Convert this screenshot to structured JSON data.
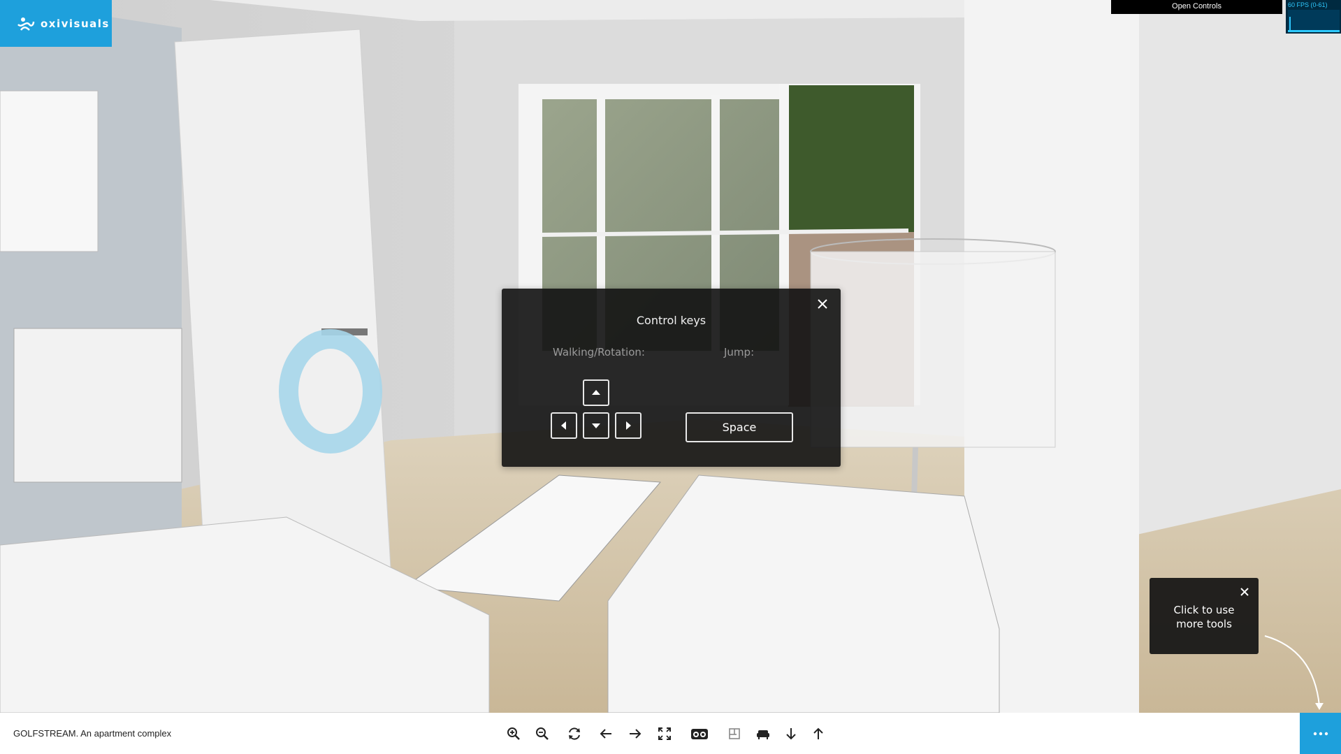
{
  "logo": {
    "text": "oxivisuals",
    "color": "#1ea0dc"
  },
  "top_right": {
    "open_controls_label": "Open Controls",
    "fps_text": "60 FPS (0-61)"
  },
  "dialog": {
    "title": "Control keys",
    "walking_label": "Walking/Rotation:",
    "jump_label": "Jump:",
    "keys": {
      "up_icon": "arrow-up-icon",
      "left_icon": "arrow-left-icon",
      "down_icon": "arrow-down-icon",
      "right_icon": "arrow-right-icon",
      "space_label": "Space"
    },
    "close_icon": "close-icon"
  },
  "tooltip": {
    "text_line1": "Click to use",
    "text_line2": "more tools",
    "close_icon": "close-icon"
  },
  "bottom_bar": {
    "project_title": "GOLFSTREAM. An apartment complex",
    "tools": [
      "zoom-in-icon",
      "zoom-out-icon",
      "rotate-icon",
      "arrow-left-icon",
      "arrow-right-icon",
      "fullscreen-icon",
      "vr-glasses-icon",
      "floorplan-icon",
      "furniture-icon",
      "arrow-down-icon",
      "arrow-up-icon"
    ],
    "more_icon": "more-dots-icon",
    "accent": "#1ea0dc"
  }
}
